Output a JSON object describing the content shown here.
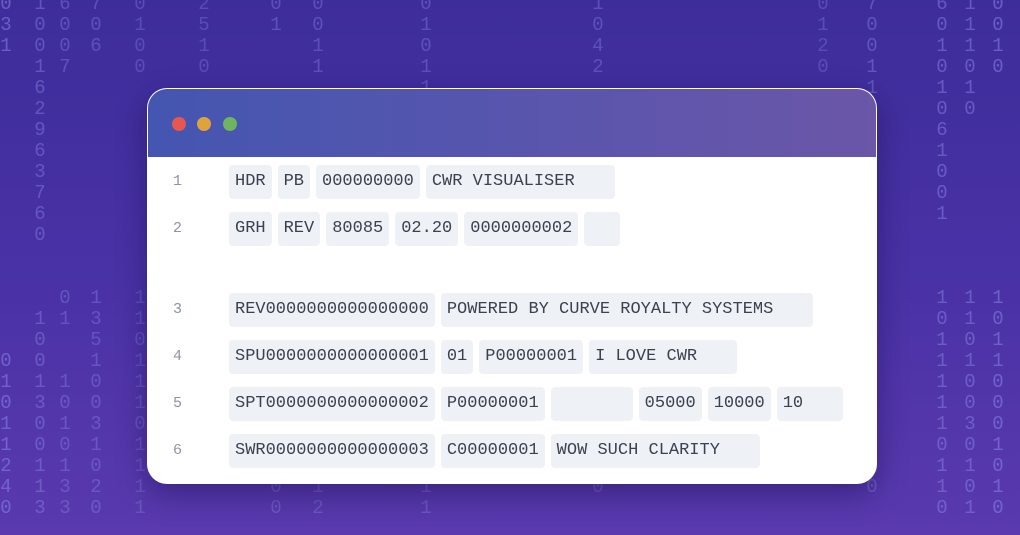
{
  "background": {
    "matrix_columns": [
      "0\n3\n1\n \n \n \n \n \n \n \n \n \n \n \n \n \n \n0\n1\n0\n1\n1\n2\n4\n0",
      "1\n0\n0\n1\n6\n2\n9\n6\n3\n7\n6\n0\n \n \n \n1\n0\n0\n1\n3\n0\n0\n1\n1\n3",
      "6\n0\n0\n7\n \n \n \n \n \n \n \n \n \n \n0\n1\n \n \n1\n0\n1\n0\n1\n3\n3",
      "7\n0\n6\n \n \n \n \n \n \n \n \n \n \n \n1\n3\n5\n1\n0\n0\n3\n1\n0\n2\n0",
      "0\n1\n0\n0\n \n \n \n \n \n \n \n \n \n \n1\n1\n0\n1\n1\n1\n0\n1\n1\n1\n1",
      "2\n5\n1\n0\n \n \n \n \n \n \n \n \n \n \n \n \n \n \n \n \n \n \n \n \n \n",
      "0\n1\n \n \n \n \n \n \n \n \n \n \n \n \n \n \n \n \n \n \n \n \n2\n0\n0",
      "0\n0\n1\n1\n \n \n \n \n \n \n \n \n \n \n \n \n \n \n \n \n \n \n1\n1\n2",
      "0\n1\n0\n1\n1\n \n \n \n \n \n \n \n \n \n \n \n \n \n \n \n \n \n \n1\n1",
      "1\n0\n4\n2\n \n \n \n \n \n \n \n \n \n \n \n \n \n \n \n \n \n \n1\n0\n \n",
      "7\n0\n0\n1\n1\n \n \n \n \n \n \n \n \n \n \n \n \n \n \n \n \n \n1\n0\n \n",
      "0\n1\n2\n0\n \n \n \n \n \n \n \n \n \n \n \n \n \n \n \n \n \n \n \n \n \n",
      "6\n0\n1\n0\n1\n0\n6\n1\n0\n0\n1\n \n \n \n1\n0\n1\n1\n1\n1\n1\n0\n1\n1\n0",
      "1\n1\n1\n0\n1\n0\n \n \n \n \n \n \n \n \n1\n1\n0\n1\n0\n0\n3\n0\n1\n0\n1",
      "0\n0\n1\n0\n \n \n \n \n \n \n \n \n \n \n1\n0\n1\n1\n0\n0\n0\n1\n0\n1\n0"
    ]
  },
  "window": {
    "rows": [
      {
        "line": "1",
        "cells": [
          "HDR",
          "PB",
          "000000000",
          "CWR VISUALISER"
        ],
        "empty": []
      },
      {
        "line": "2",
        "cells": [
          "GRH",
          "REV",
          "80085",
          "02.20",
          "0000000002",
          ""
        ],
        "empty": [
          5
        ]
      },
      {
        "line": "3",
        "cells": [
          "REV0000000000000000",
          "POWERED BY CURVE ROYALTY SYSTEMS"
        ],
        "empty": []
      },
      {
        "line": "4",
        "cells": [
          "SPU0000000000000001",
          "01",
          "P00000001",
          "I LOVE CWR"
        ],
        "empty": []
      },
      {
        "line": "5",
        "cells": [
          "SPT0000000000000002",
          "P00000001",
          "",
          "05000",
          "10000",
          "10"
        ],
        "empty": [
          2
        ]
      },
      {
        "line": "6",
        "cells": [
          "SWR0000000000000003",
          "C00000001",
          "WOW SUCH CLARITY"
        ],
        "empty": []
      }
    ]
  },
  "colors": {
    "close": "#e5574f",
    "minimize": "#e0a23a",
    "maximize": "#6fb560",
    "cell_bg": "#eef1f5",
    "cell_text": "#3c4150",
    "line_number": "#8e94a4"
  }
}
